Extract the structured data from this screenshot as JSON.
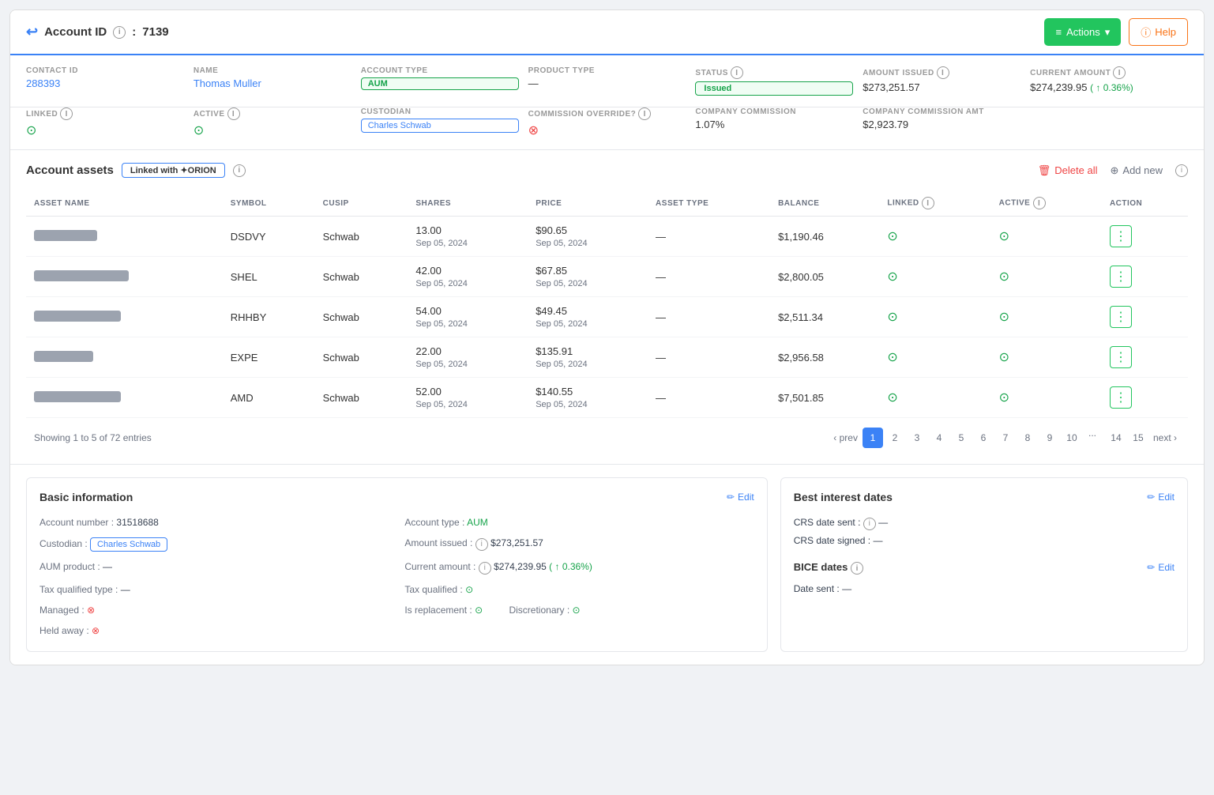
{
  "header": {
    "account_id_label": "Account ID",
    "account_id_value": "7139",
    "actions_label": "Actions",
    "help_label": "Help"
  },
  "account_info": {
    "contact_id_label": "CONTACT ID",
    "contact_id_value": "288393",
    "name_label": "NAME",
    "name_value": "Thomas Muller",
    "account_type_label": "ACCOUNT TYPE",
    "account_type_value": "AUM",
    "product_type_label": "PRODUCT TYPE",
    "product_type_value": "—",
    "status_label": "STATUS",
    "status_value": "Issued",
    "amount_issued_label": "AMOUNT ISSUED",
    "amount_issued_value": "$273,251.57",
    "current_amount_label": "CURRENT AMOUNT",
    "current_amount_value": "$274,239.95",
    "current_amount_change": "0.36%",
    "linked_label": "LINKED",
    "active_label": "ACTIVE",
    "custodian_label": "CUSTODIAN",
    "custodian_value": "Charles Schwab",
    "commission_override_label": "COMMISSION OVERRIDE?",
    "company_commission_label": "COMPANY COMMISSION",
    "company_commission_value": "1.07%",
    "company_commission_amt_label": "COMPANY COMMISSION AMT",
    "company_commission_amt_value": "$2,923.79"
  },
  "assets_section": {
    "title": "Account assets",
    "linked_badge": "Linked with ✦ORION",
    "delete_all_label": "Delete all",
    "add_new_label": "Add new",
    "table": {
      "headers": [
        "ASSET NAME",
        "SYMBOL",
        "CUSIP",
        "SHARES",
        "PRICE",
        "ASSET TYPE",
        "BALANCE",
        "LINKED",
        "ACTIVE",
        "ACTION"
      ],
      "rows": [
        {
          "symbol": "DSDVY",
          "cusip": "Schwab",
          "shares": "13.00",
          "shares_date": "Sep 05, 2024",
          "price": "$90.65",
          "price_date": "Sep 05, 2024",
          "asset_type": "—",
          "balance": "$1,190.46",
          "name_width": 80
        },
        {
          "symbol": "SHEL",
          "cusip": "Schwab",
          "shares": "42.00",
          "shares_date": "Sep 05, 2024",
          "price": "$67.85",
          "price_date": "Sep 05, 2024",
          "asset_type": "—",
          "balance": "$2,800.05",
          "name_width": 120
        },
        {
          "symbol": "RHHBY",
          "cusip": "Schwab",
          "shares": "54.00",
          "shares_date": "Sep 05, 2024",
          "price": "$49.45",
          "price_date": "Sep 05, 2024",
          "asset_type": "—",
          "balance": "$2,511.34",
          "name_width": 110
        },
        {
          "symbol": "EXPE",
          "cusip": "Schwab",
          "shares": "22.00",
          "shares_date": "Sep 05, 2024",
          "price": "$135.91",
          "price_date": "Sep 05, 2024",
          "asset_type": "—",
          "balance": "$2,956.58",
          "name_width": 75
        },
        {
          "symbol": "AMD",
          "cusip": "Schwab",
          "shares": "52.00",
          "shares_date": "Sep 05, 2024",
          "price": "$140.55",
          "price_date": "Sep 05, 2024",
          "asset_type": "—",
          "balance": "$7,501.85",
          "name_width": 110
        }
      ]
    },
    "pagination": {
      "info": "Showing 1 to 5 of 72 entries",
      "prev": "prev",
      "next": "next",
      "pages": [
        "1",
        "2",
        "3",
        "4",
        "5",
        "6",
        "7",
        "8",
        "9",
        "10",
        "...",
        "14",
        "15"
      ],
      "current": 1
    }
  },
  "basic_info": {
    "title": "Basic information",
    "edit_label": "Edit",
    "account_number_label": "Account number :",
    "account_number_value": "31518688",
    "account_type_label": "Account type :",
    "account_type_value": "AUM",
    "custodian_label": "Custodian :",
    "custodian_value": "Charles Schwab",
    "aum_product_label": "AUM product :",
    "aum_product_value": "—",
    "amount_issued_label": "Amount issued :",
    "amount_issued_value": "$273,251.57",
    "current_amount_label": "Current amount :",
    "current_amount_value": "$274,239.95",
    "current_amount_change": "0.36%",
    "tax_qualified_label": "Tax qualified :",
    "tax_qualified_type_label": "Tax qualified type :",
    "tax_qualified_type_value": "—",
    "is_replacement_label": "Is replacement :",
    "discretionary_label": "Discretionary :",
    "managed_label": "Managed :",
    "held_away_label": "Held away :"
  },
  "best_interest": {
    "title": "Best interest dates",
    "edit_label": "Edit",
    "crs_date_sent_label": "CRS date sent :",
    "crs_date_sent_value": "—",
    "crs_date_signed_label": "CRS date signed :",
    "crs_date_signed_value": "—",
    "bice_dates_label": "BICE dates",
    "bice_edit_label": "Edit",
    "date_sent_label": "Date sent :",
    "date_sent_value": "—"
  },
  "icons": {
    "back": "↩",
    "info": "i",
    "menu_lines": "≡",
    "help_circle": "ⓘ",
    "chevron_down": "▾",
    "trash": "🗑",
    "plus_circle": "⊕",
    "check_circle": "✓",
    "x_circle": "✕",
    "arrow_up": "↑",
    "edit": "✏",
    "dots_vertical": "⋮"
  },
  "colors": {
    "blue": "#3b82f6",
    "green": "#22c55e",
    "red": "#ef4444",
    "orange": "#f97316",
    "gray_text": "#6b7280"
  }
}
